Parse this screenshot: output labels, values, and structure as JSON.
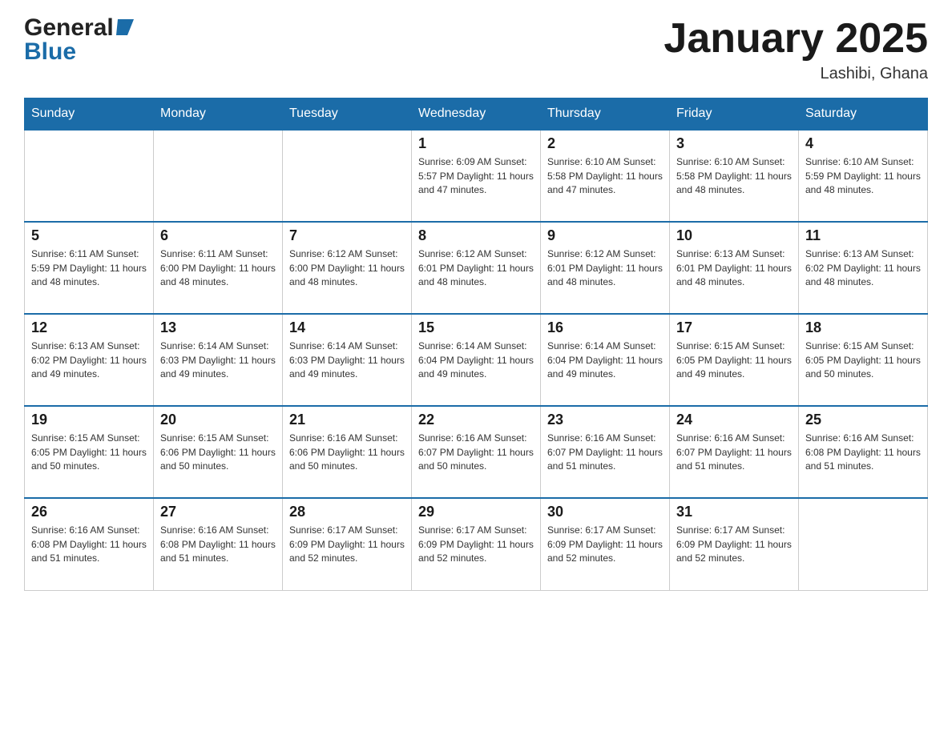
{
  "header": {
    "logo_general": "General",
    "logo_blue": "Blue",
    "title": "January 2025",
    "location": "Lashibi, Ghana"
  },
  "days_of_week": [
    "Sunday",
    "Monday",
    "Tuesday",
    "Wednesday",
    "Thursday",
    "Friday",
    "Saturday"
  ],
  "weeks": [
    [
      {
        "day": "",
        "info": ""
      },
      {
        "day": "",
        "info": ""
      },
      {
        "day": "",
        "info": ""
      },
      {
        "day": "1",
        "info": "Sunrise: 6:09 AM\nSunset: 5:57 PM\nDaylight: 11 hours\nand 47 minutes."
      },
      {
        "day": "2",
        "info": "Sunrise: 6:10 AM\nSunset: 5:58 PM\nDaylight: 11 hours\nand 47 minutes."
      },
      {
        "day": "3",
        "info": "Sunrise: 6:10 AM\nSunset: 5:58 PM\nDaylight: 11 hours\nand 48 minutes."
      },
      {
        "day": "4",
        "info": "Sunrise: 6:10 AM\nSunset: 5:59 PM\nDaylight: 11 hours\nand 48 minutes."
      }
    ],
    [
      {
        "day": "5",
        "info": "Sunrise: 6:11 AM\nSunset: 5:59 PM\nDaylight: 11 hours\nand 48 minutes."
      },
      {
        "day": "6",
        "info": "Sunrise: 6:11 AM\nSunset: 6:00 PM\nDaylight: 11 hours\nand 48 minutes."
      },
      {
        "day": "7",
        "info": "Sunrise: 6:12 AM\nSunset: 6:00 PM\nDaylight: 11 hours\nand 48 minutes."
      },
      {
        "day": "8",
        "info": "Sunrise: 6:12 AM\nSunset: 6:01 PM\nDaylight: 11 hours\nand 48 minutes."
      },
      {
        "day": "9",
        "info": "Sunrise: 6:12 AM\nSunset: 6:01 PM\nDaylight: 11 hours\nand 48 minutes."
      },
      {
        "day": "10",
        "info": "Sunrise: 6:13 AM\nSunset: 6:01 PM\nDaylight: 11 hours\nand 48 minutes."
      },
      {
        "day": "11",
        "info": "Sunrise: 6:13 AM\nSunset: 6:02 PM\nDaylight: 11 hours\nand 48 minutes."
      }
    ],
    [
      {
        "day": "12",
        "info": "Sunrise: 6:13 AM\nSunset: 6:02 PM\nDaylight: 11 hours\nand 49 minutes."
      },
      {
        "day": "13",
        "info": "Sunrise: 6:14 AM\nSunset: 6:03 PM\nDaylight: 11 hours\nand 49 minutes."
      },
      {
        "day": "14",
        "info": "Sunrise: 6:14 AM\nSunset: 6:03 PM\nDaylight: 11 hours\nand 49 minutes."
      },
      {
        "day": "15",
        "info": "Sunrise: 6:14 AM\nSunset: 6:04 PM\nDaylight: 11 hours\nand 49 minutes."
      },
      {
        "day": "16",
        "info": "Sunrise: 6:14 AM\nSunset: 6:04 PM\nDaylight: 11 hours\nand 49 minutes."
      },
      {
        "day": "17",
        "info": "Sunrise: 6:15 AM\nSunset: 6:05 PM\nDaylight: 11 hours\nand 49 minutes."
      },
      {
        "day": "18",
        "info": "Sunrise: 6:15 AM\nSunset: 6:05 PM\nDaylight: 11 hours\nand 50 minutes."
      }
    ],
    [
      {
        "day": "19",
        "info": "Sunrise: 6:15 AM\nSunset: 6:05 PM\nDaylight: 11 hours\nand 50 minutes."
      },
      {
        "day": "20",
        "info": "Sunrise: 6:15 AM\nSunset: 6:06 PM\nDaylight: 11 hours\nand 50 minutes."
      },
      {
        "day": "21",
        "info": "Sunrise: 6:16 AM\nSunset: 6:06 PM\nDaylight: 11 hours\nand 50 minutes."
      },
      {
        "day": "22",
        "info": "Sunrise: 6:16 AM\nSunset: 6:07 PM\nDaylight: 11 hours\nand 50 minutes."
      },
      {
        "day": "23",
        "info": "Sunrise: 6:16 AM\nSunset: 6:07 PM\nDaylight: 11 hours\nand 51 minutes."
      },
      {
        "day": "24",
        "info": "Sunrise: 6:16 AM\nSunset: 6:07 PM\nDaylight: 11 hours\nand 51 minutes."
      },
      {
        "day": "25",
        "info": "Sunrise: 6:16 AM\nSunset: 6:08 PM\nDaylight: 11 hours\nand 51 minutes."
      }
    ],
    [
      {
        "day": "26",
        "info": "Sunrise: 6:16 AM\nSunset: 6:08 PM\nDaylight: 11 hours\nand 51 minutes."
      },
      {
        "day": "27",
        "info": "Sunrise: 6:16 AM\nSunset: 6:08 PM\nDaylight: 11 hours\nand 51 minutes."
      },
      {
        "day": "28",
        "info": "Sunrise: 6:17 AM\nSunset: 6:09 PM\nDaylight: 11 hours\nand 52 minutes."
      },
      {
        "day": "29",
        "info": "Sunrise: 6:17 AM\nSunset: 6:09 PM\nDaylight: 11 hours\nand 52 minutes."
      },
      {
        "day": "30",
        "info": "Sunrise: 6:17 AM\nSunset: 6:09 PM\nDaylight: 11 hours\nand 52 minutes."
      },
      {
        "day": "31",
        "info": "Sunrise: 6:17 AM\nSunset: 6:09 PM\nDaylight: 11 hours\nand 52 minutes."
      },
      {
        "day": "",
        "info": ""
      }
    ]
  ]
}
